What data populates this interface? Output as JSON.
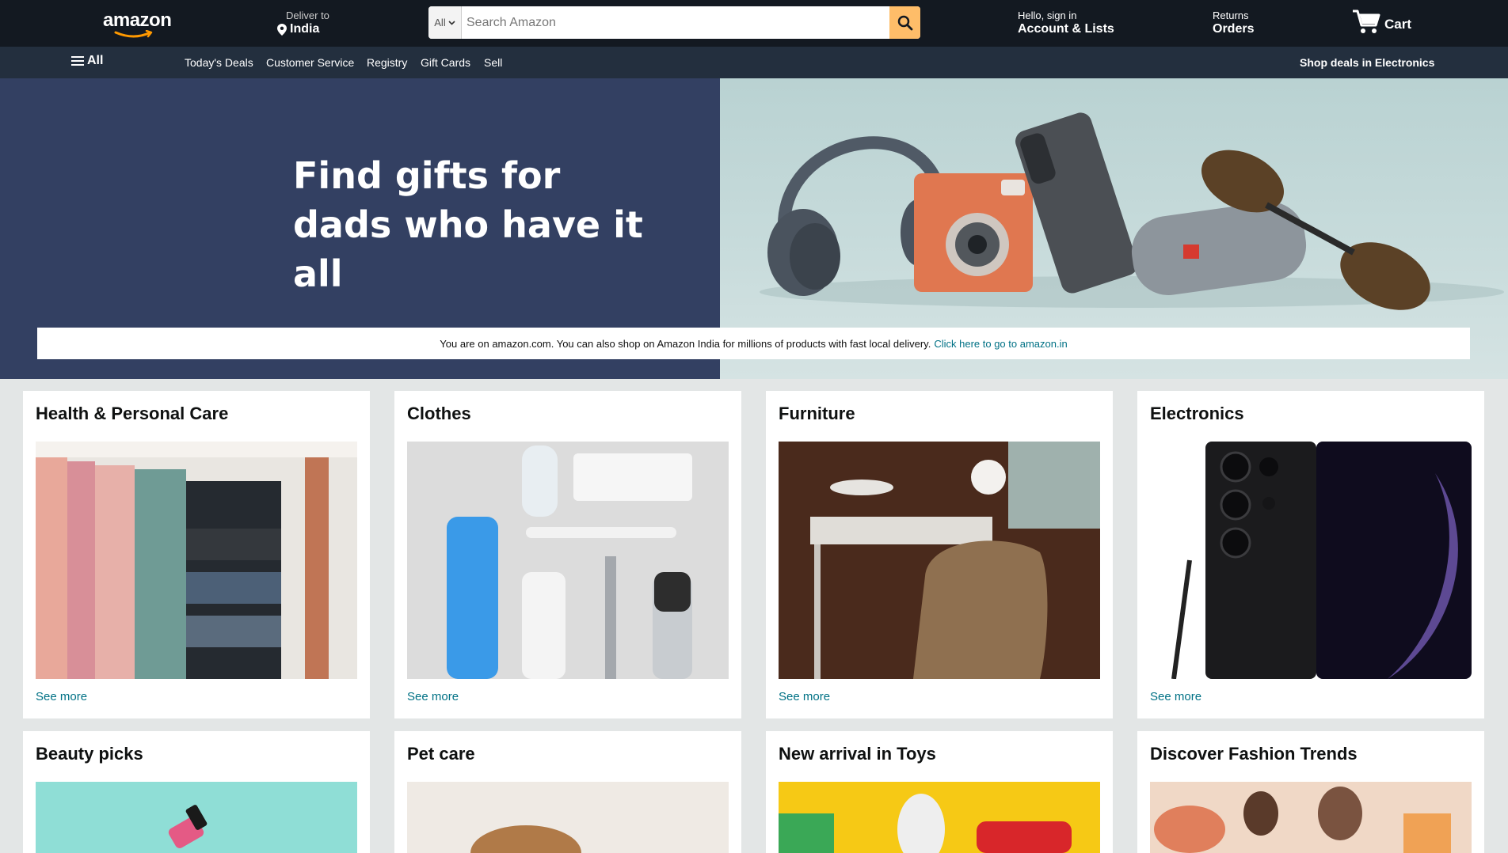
{
  "header": {
    "logo": "amazon",
    "deliver_small": "Deliver to",
    "deliver_country": "India",
    "search_category": "All",
    "search_placeholder": "Search Amazon",
    "account_small": "Hello, sign in",
    "account_big": "Account & Lists",
    "returns_small": "Returns",
    "returns_big": "Orders",
    "cart_label": "Cart"
  },
  "subnav": {
    "all_label": "All",
    "items": [
      "Today's Deals",
      "Customer Service",
      "Registry",
      "Gift Cards",
      "Sell"
    ],
    "promo": "Shop deals in Electronics"
  },
  "hero": {
    "title_line1": "Find gifts for",
    "title_line2": "dads who have it all",
    "notice_text": "You are on amazon.com. You can also shop on Amazon India for millions of products with fast local delivery.",
    "notice_link": "Click here to go to amazon.in"
  },
  "cards": [
    {
      "title": "Health & Personal Care",
      "link": "See more"
    },
    {
      "title": "Clothes",
      "link": "See more"
    },
    {
      "title": "Furniture",
      "link": "See more"
    },
    {
      "title": "Electronics",
      "link": "See more"
    },
    {
      "title": "Beauty picks"
    },
    {
      "title": "Pet care"
    },
    {
      "title": "New arrival in Toys"
    },
    {
      "title": "Discover Fashion Trends"
    }
  ],
  "colors": {
    "nav_bg": "#131921",
    "subnav_bg": "#232f3e",
    "search_button": "#febd69",
    "link": "#007185",
    "hero_left": "#334062",
    "page_bg": "#e3e6e6"
  }
}
